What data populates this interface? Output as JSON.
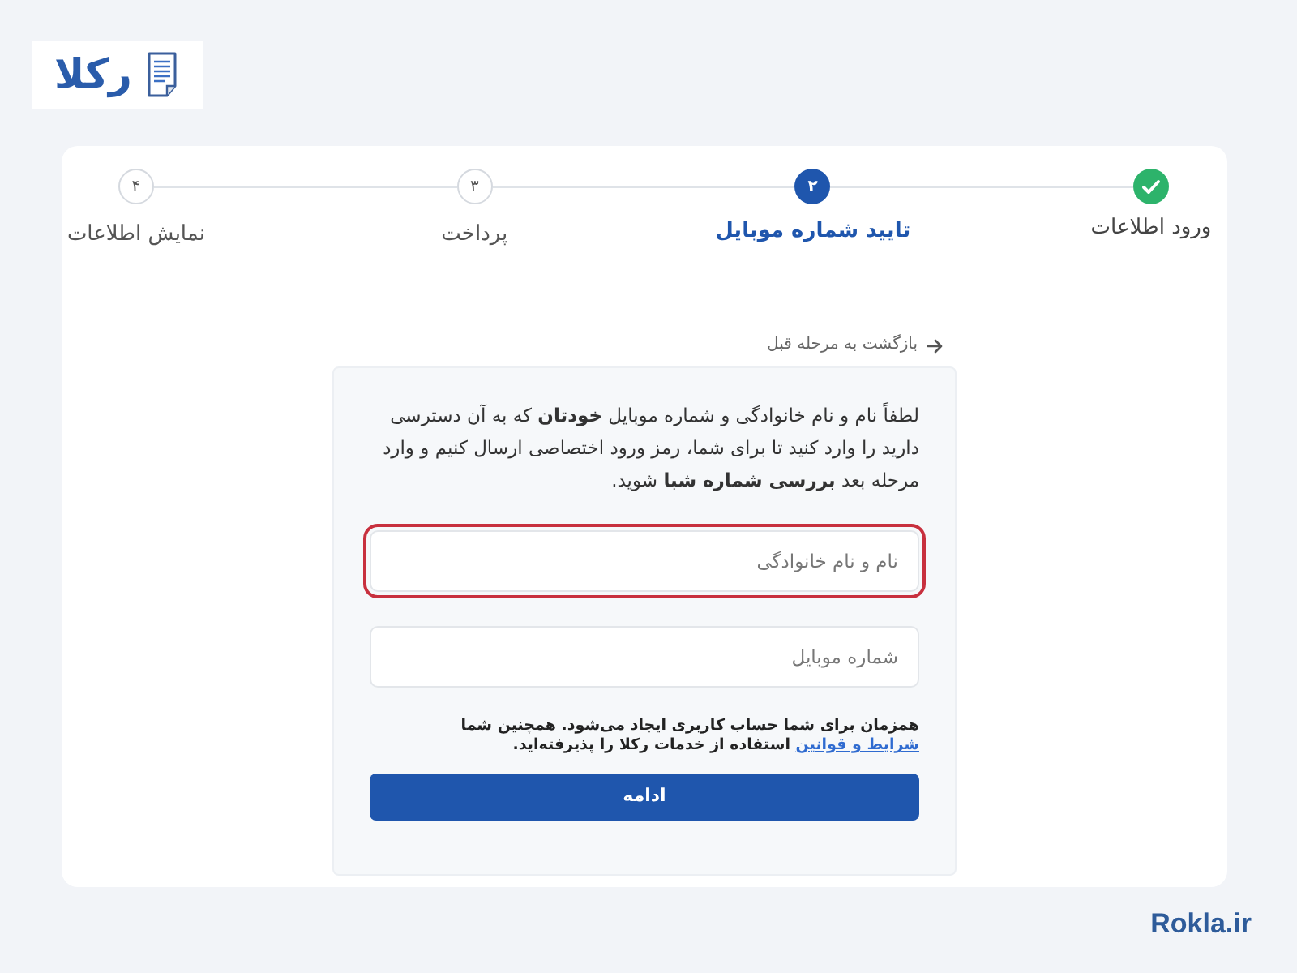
{
  "logo": {
    "text": "رکلا"
  },
  "steps": [
    {
      "label": "ورود اطلاعات",
      "completed": true,
      "selected": false
    },
    {
      "number": "۲",
      "label": "تایید شماره موبایل",
      "completed": false,
      "selected": true
    },
    {
      "number": "۳",
      "label": "پرداخت",
      "completed": false,
      "selected": false
    },
    {
      "number": "۴",
      "label": "نمایش اطلاعات",
      "completed": false,
      "selected": false
    }
  ],
  "back_link": {
    "label": "بازگشت به مرحله قبل"
  },
  "form": {
    "intro": "لطفاً نام و نام خانوادگی و شماره موبایل **خودتان** که به آن دسترسی دارید را وارد کنید تا برای شما، رمز ورود اختصاصی ارسال کنیم و وارد مرحله بعد **بررسی شماره شبا** شوید.",
    "fields": [
      {
        "placeholder": "نام و نام خانوادگی",
        "invalid": true
      },
      {
        "placeholder": "شماره موبایل",
        "invalid": false
      }
    ],
    "terms": {
      "before": "همزمان برای شما حساب کاربری ایجاد می‌شود. همچنین شما",
      "link": "شرایط و قوانین",
      "after": "استفاده از خدمات رکلا را پذیرفته‌اید."
    },
    "submit": "ادامه"
  },
  "footer": {
    "site": "Rokla.ir"
  }
}
